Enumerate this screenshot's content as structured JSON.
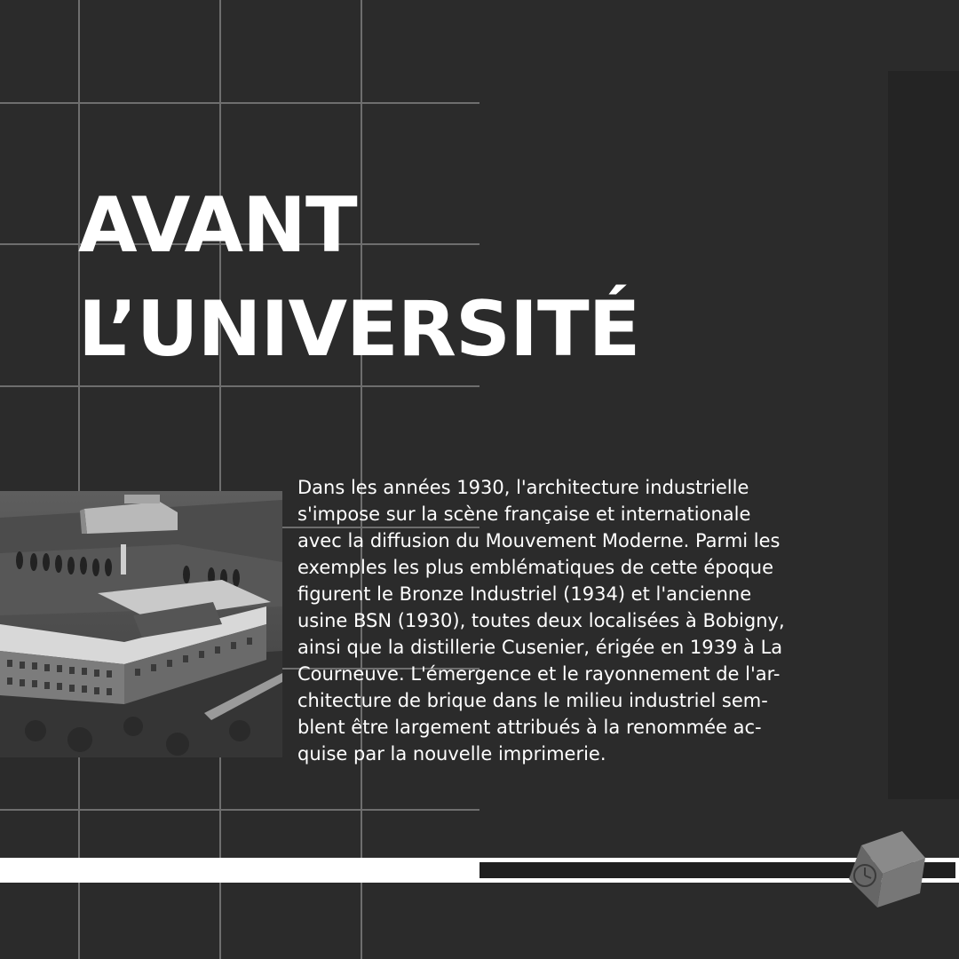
{
  "title": {
    "line1": "AVANT",
    "line2": "L’UNIVERSITÉ"
  },
  "body": {
    "lines": [
      "Dans les années 1930, l'architecture industrielle",
      "s'impose sur la scène française et internationale",
      "avec la diffusion du Mouvement Moderne. Parmi les",
      "exemples les plus emblématiques de cette époque",
      "figurent le Bronze Industriel (1934) et l'ancienne",
      "usine BSN (1930), toutes deux localisées à Bobigny,",
      "ainsi que la distillerie Cusenier, érigée en 1939 à La",
      "Courneuve. L'émergence et le rayonnement de l'ar-",
      "chitecture de brique dans le milieu industriel sem-",
      "blent être largement attribués à la renommée ac-",
      "quise par la nouvelle imprimerie."
    ]
  },
  "images": {
    "photo": "aerial-view-industrial-building-photo",
    "logo": "cube-clock-logo"
  },
  "colors": {
    "background": "#2b2b2b",
    "panel": "#242424",
    "grid": "#6e6e6e",
    "text": "#ffffff",
    "bar": "#ffffff",
    "bar_inner": "#1f1f1f",
    "logo": "#777777"
  }
}
